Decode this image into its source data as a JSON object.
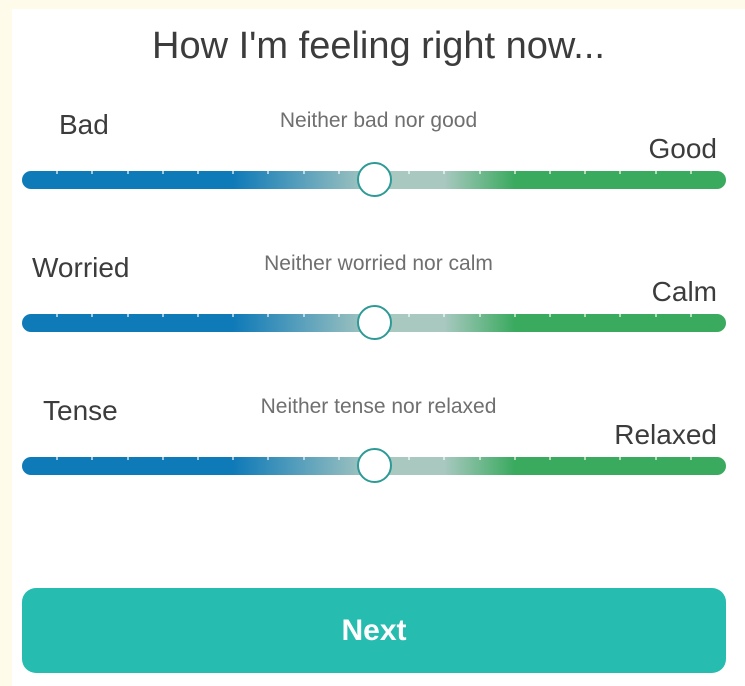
{
  "title": "How I'm feeling right now...",
  "colors": {
    "track_left": "#0f7ab8",
    "track_mid": "#a8c8c0",
    "track_right": "#3aaa5f",
    "thumb_border": "#2e9a96",
    "button": "#26bcb0"
  },
  "sliders": [
    {
      "left_label": "Bad",
      "middle_label": "Neither bad nor good",
      "right_label": "Good",
      "value": 0.5
    },
    {
      "left_label": "Worried",
      "middle_label": "Neither worried nor calm",
      "right_label": "Calm",
      "value": 0.5
    },
    {
      "left_label": "Tense",
      "middle_label": "Neither tense nor relaxed",
      "right_label": "Relaxed",
      "value": 0.5
    }
  ],
  "next_button": {
    "label": "Next"
  }
}
